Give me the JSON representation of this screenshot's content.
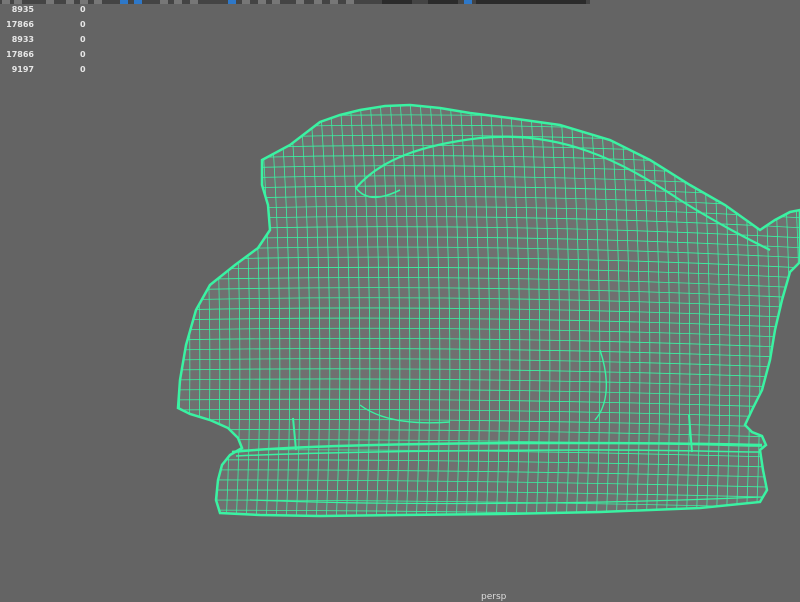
{
  "toolbar": {
    "colors": {
      "bar": "#444444",
      "button": "#777777",
      "active": "#2e78c8",
      "field": "#2b2b2b"
    }
  },
  "hud": {
    "rows": [
      {
        "value": "8935",
        "extra": "0"
      },
      {
        "value": "17866",
        "extra": "0"
      },
      {
        "value": "8933",
        "extra": "0"
      },
      {
        "value": "17866",
        "extra": "0"
      },
      {
        "value": "9197",
        "extra": "0"
      }
    ]
  },
  "viewport": {
    "background": "#646464",
    "wire_color": "#3af2a2",
    "camera": "persp"
  }
}
